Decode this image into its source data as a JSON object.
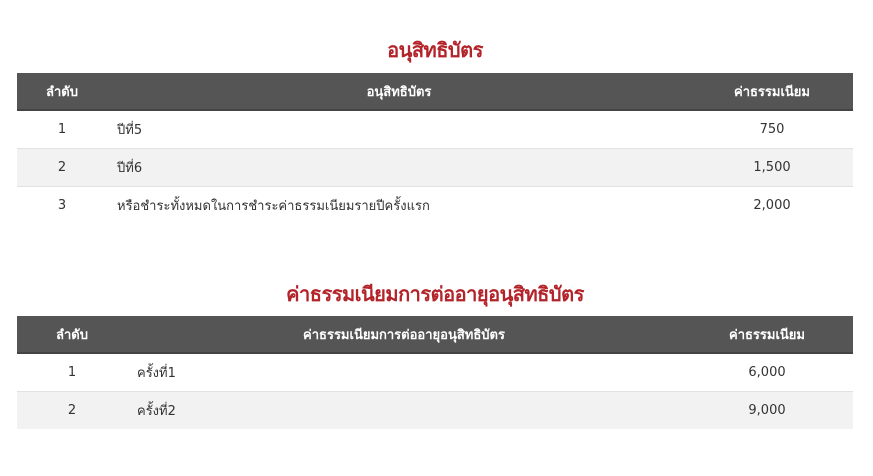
{
  "table1": {
    "title": "อนุสิทธิบัตร",
    "headers": {
      "no": "ลำดับ",
      "item": "อนุสิทธิบัตร",
      "fee": "ค่าธรรมเนียม"
    },
    "rows": [
      {
        "no": "1",
        "item": "ปีที่5",
        "fee": "750"
      },
      {
        "no": "2",
        "item": "ปีที่6",
        "fee": "1,500"
      },
      {
        "no": "3",
        "item": "หรือชำระทั้งหมดในการชำระค่าธรรมเนียมรายปีครั้งแรก",
        "fee": "2,000"
      }
    ]
  },
  "table2": {
    "title": "ค่าธรรมเนียมการต่ออายุอนุสิทธิบัตร",
    "headers": {
      "no": "ลำดับ",
      "item": "ค่าธรรมเนียมการต่ออายุอนุสิทธิบัตร",
      "fee": "ค่าธรรมเนียม"
    },
    "rows": [
      {
        "no": "1",
        "item": "ครั้งที่1",
        "fee": "6,000"
      },
      {
        "no": "2",
        "item": "ครั้งที่2",
        "fee": "9,000"
      }
    ]
  },
  "colors": {
    "title": "#b3232a",
    "header_bg": "#555555",
    "alt_row_bg": "#f2f2f2"
  }
}
